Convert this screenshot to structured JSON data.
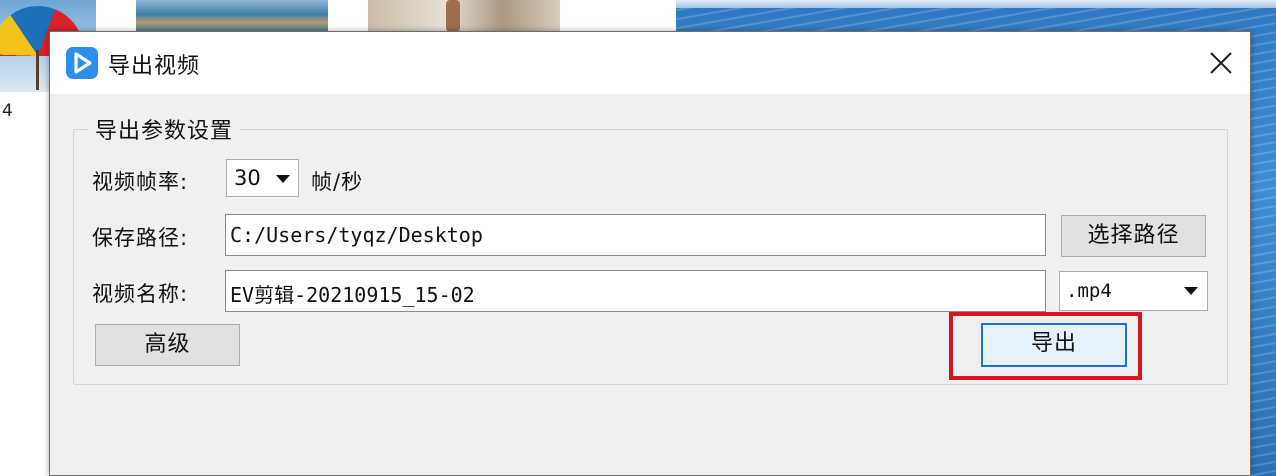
{
  "background": {
    "corner_number": "4"
  },
  "dialog": {
    "title": "导出视频",
    "close_icon": "close-icon",
    "app_icon": "play-logo-icon",
    "group_title": "导出参数设置",
    "fps": {
      "label": "视频帧率:",
      "value": "30",
      "unit": "帧/秒"
    },
    "save_path": {
      "label": "保存路径:",
      "value": "C:/Users/tyqz/Desktop",
      "browse_button": "选择路径"
    },
    "video_name": {
      "label": "视频名称:",
      "value": "EV剪辑-20210915_15-02",
      "format": ".mp4"
    },
    "advanced_button": "高级",
    "export_button": "导出"
  },
  "colors": {
    "accent": "#2b8ff0",
    "highlight": "#d8141f",
    "export_border": "#1b75d0"
  }
}
